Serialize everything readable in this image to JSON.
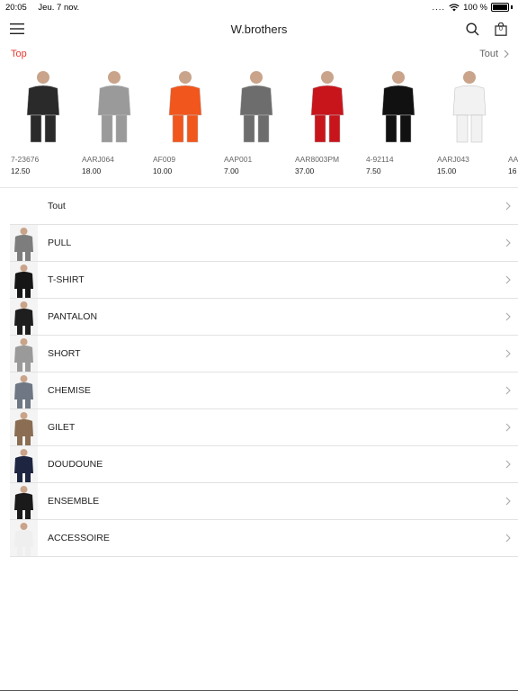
{
  "status": {
    "time": "20:05",
    "date": "Jeu. 7 nov.",
    "battery": "100 %"
  },
  "header": {
    "title": "W.brothers",
    "menu_icon": "hamburger-icon",
    "search_icon": "search-icon",
    "cart_icon": "shopping-bag-icon",
    "cart_count": "0"
  },
  "top": {
    "label": "Top",
    "see_all": "Tout",
    "products": [
      {
        "code": "7-23676",
        "price": "12.50",
        "color": "#2a2a2a"
      },
      {
        "code": "AARJ064",
        "price": "18.00",
        "color": "#9a9a9a"
      },
      {
        "code": "AF009",
        "price": "10.00",
        "color": "#f1561c"
      },
      {
        "code": "AAP001",
        "price": "7.00",
        "color": "#6d6d6d"
      },
      {
        "code": "AAR8003PM",
        "price": "37.00",
        "color": "#c8151c"
      },
      {
        "code": "4-92114",
        "price": "7.50",
        "color": "#111111"
      },
      {
        "code": "AARJ043",
        "price": "15.00",
        "color": "#f2f2f2"
      },
      {
        "code": "AA",
        "price": "16",
        "color": "#dddddd"
      }
    ]
  },
  "categories": [
    {
      "label": "Tout",
      "thumb": ""
    },
    {
      "label": "PULL",
      "thumb": "#7d7d7d"
    },
    {
      "label": "T-SHIRT",
      "thumb": "#161616"
    },
    {
      "label": "PANTALON",
      "thumb": "#1e1e1e"
    },
    {
      "label": "SHORT",
      "thumb": "#9a9a9a"
    },
    {
      "label": "CHEMISE",
      "thumb": "#6f7784"
    },
    {
      "label": "GILET",
      "thumb": "#8a6d52"
    },
    {
      "label": "DOUDOUNE",
      "thumb": "#1d2540"
    },
    {
      "label": "ENSEMBLE",
      "thumb": "#1a1a1a"
    },
    {
      "label": "ACCESSOIRE",
      "thumb": "#efefef"
    }
  ]
}
